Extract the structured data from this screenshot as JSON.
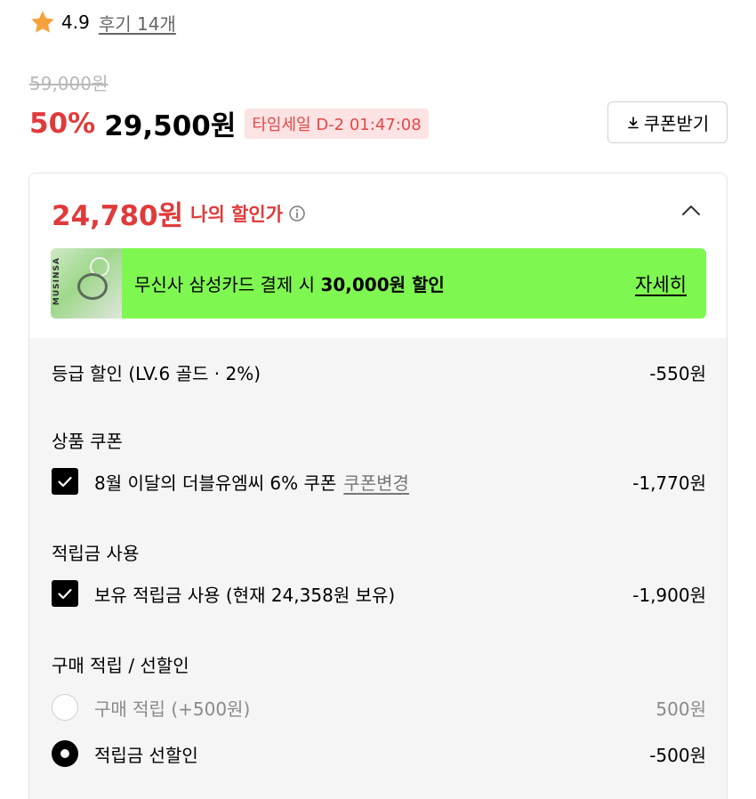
{
  "rating": {
    "score": "4.9",
    "reviews": "후기 14개",
    "icon": "star-icon",
    "star_color": "#f5a23d"
  },
  "price": {
    "original": "59,000원",
    "discount_rate": "50%",
    "sale": "29,500원",
    "timesale": "타임세일 D-2 01:47:08"
  },
  "coupon_button": {
    "label": "쿠폰받기",
    "icon": "download-icon"
  },
  "my_price": {
    "amount": "24,780원",
    "label": "나의 할인가",
    "info_icon": "info-icon",
    "collapse_icon": "chevron-up-icon"
  },
  "banner": {
    "text_prefix": "무신사 삼성카드 결제 시 ",
    "text_bold": "30,000원 할인",
    "link": "자세히",
    "thumb_text": "MUSINSA",
    "bg_color": "#7ff751"
  },
  "grade_discount": {
    "label": "등급 할인 (LV.6 골드 · 2%)",
    "amount": "-550원"
  },
  "product_coupon": {
    "title": "상품 쿠폰",
    "item_label": "8월 이달의 더블유엠씨 6% 쿠폰",
    "change_link": "쿠폰변경",
    "amount": "-1,770원",
    "checked": true
  },
  "points": {
    "title": "적립금 사용",
    "item_label": "보유 적립금 사용 (현재 24,358원 보유)",
    "amount": "-1,900원",
    "checked": true
  },
  "purchase_reward": {
    "title": "구매 적립 / 선할인",
    "options": [
      {
        "label": "구매 적립 (+500원)",
        "amount": "500원",
        "selected": false
      },
      {
        "label": "적립금 선할인",
        "amount": "-500원",
        "selected": true
      }
    ]
  },
  "colors": {
    "accent_red": "#e03a3a",
    "timesale_bg": "#fde3e3",
    "body_bg": "#f5f5f5"
  }
}
